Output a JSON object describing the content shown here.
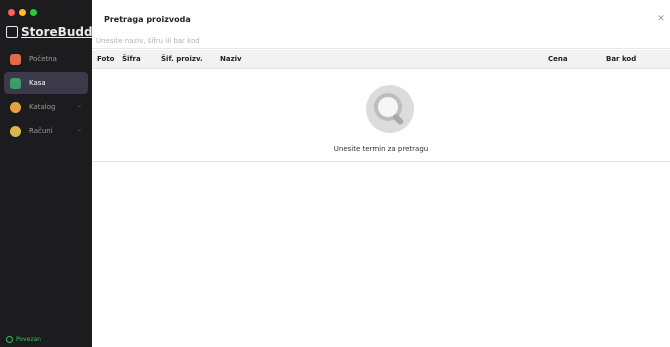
{
  "app": {
    "name": "StoreBuddy"
  },
  "sidebar": {
    "items": [
      {
        "label": "Početna",
        "icon": "home-icon"
      },
      {
        "label": "Kasa",
        "icon": "register-icon",
        "active": true
      },
      {
        "label": "Katalog",
        "icon": "catalog-icon"
      },
      {
        "label": "Računi",
        "icon": "receipts-icon"
      }
    ],
    "status": "Povezan"
  },
  "dialog": {
    "title": "Pretraga proizvoda",
    "search_placeholder": "Unesite naziv, šifru ili bar kod",
    "columns": [
      "Foto",
      "Šifra",
      "Šif. proizv.",
      "Naziv",
      "Cena",
      "Bar kod"
    ],
    "empty_text": "Unesite termin za pretragu"
  }
}
